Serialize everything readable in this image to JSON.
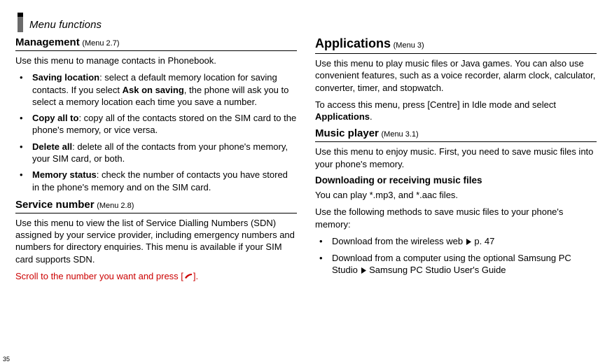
{
  "header": {
    "breadcrumb": "Menu functions"
  },
  "left": {
    "s1": {
      "title": "Management",
      "menu": "(Menu 2.7)",
      "intro": "Use this menu to manage contacts in Phonebook.",
      "bullets": [
        {
          "term": "Saving location",
          "text_a": ": select a default memory location for saving contacts. If you select ",
          "bold_mid": "Ask on saving",
          "text_b": ", the phone will ask you to select a memory location each time you save a number."
        },
        {
          "term": "Copy all to",
          "text_a": ": copy all of the contacts stored on the SIM card to the phone's memory, or vice versa.",
          "bold_mid": "",
          "text_b": ""
        },
        {
          "term": "Delete all",
          "text_a": ": delete all of the contacts from your phone's memory, your SIM card, or both.",
          "bold_mid": "",
          "text_b": ""
        },
        {
          "term": "Memory status",
          "text_a": ": check the number of contacts you have stored in the phone's memory and on the SIM card.",
          "bold_mid": "",
          "text_b": ""
        }
      ]
    },
    "s2": {
      "title": "Service number",
      "menu": "(Menu 2.8)",
      "intro": "Use this menu to view the list of Service Dialling Numbers (SDN) assigned by your service provider, including emergency numbers and numbers for directory enquiries. This menu is available if your SIM card supports SDN.",
      "action_pre": "Scroll to the number you want and press [",
      "action_post": "]."
    }
  },
  "right": {
    "s1": {
      "title": "Applications",
      "menu": "(Menu 3)",
      "p1": "Use this menu to play music files or Java games. You can also use convenient features, such as a voice recorder, alarm clock, calculator, converter, timer, and stopwatch.",
      "p2_a": "To access this menu, press [Centre] in Idle mode and select ",
      "p2_bold": "Applications",
      "p2_b": "."
    },
    "s2": {
      "title": "Music player",
      "menu": "(Menu 3.1)",
      "intro": "Use this menu to enjoy music. First, you need to save music files into your phone's memory."
    },
    "s3": {
      "title": "Downloading or receiving music files",
      "p1": "You can play *.mp3, and *.aac files.",
      "p2": "Use the following methods to save music files to your phone's memory:",
      "bullets": [
        {
          "pre": "Download from the wireless web",
          "post": "p. 47"
        },
        {
          "pre": "Download from a computer using the optional Samsung PC Studio",
          "post": "Samsung PC Studio User's Guide"
        }
      ]
    }
  },
  "page_number": "35"
}
